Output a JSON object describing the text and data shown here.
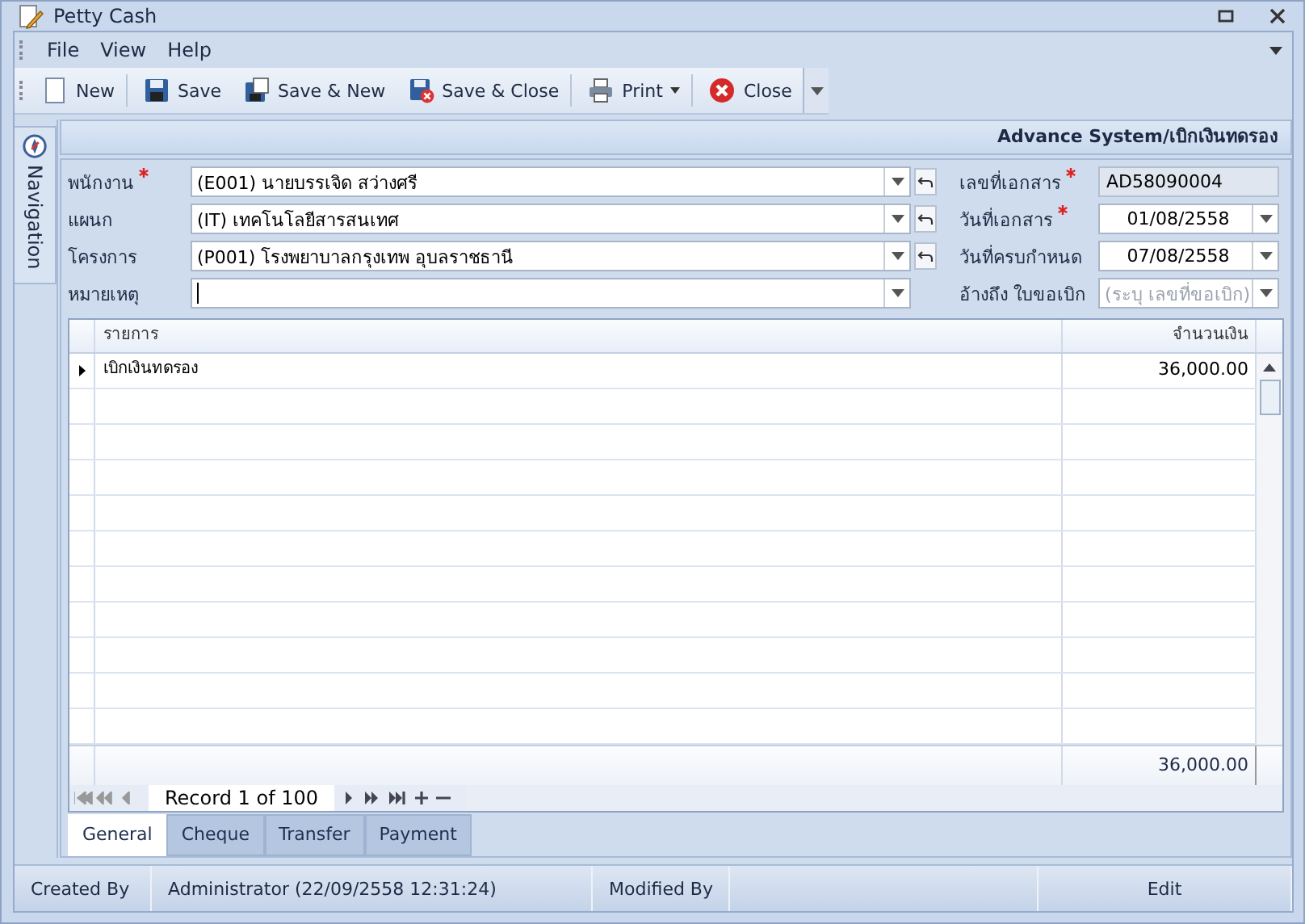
{
  "window": {
    "title": "Petty Cash"
  },
  "menu": [
    "File",
    "View",
    "Help"
  ],
  "toolbar": [
    {
      "kind": "new",
      "label": "New"
    },
    {
      "kind": "save",
      "label": "Save"
    },
    {
      "kind": "save_new",
      "label": "Save & New"
    },
    {
      "kind": "save_close",
      "label": "Save & Close"
    },
    {
      "kind": "print",
      "label": "Print"
    },
    {
      "kind": "close",
      "label": "Close"
    }
  ],
  "navigation": {
    "label": "Navigation"
  },
  "header": "Advance System/เบิกเงินทดรอง",
  "left_fields": [
    {
      "label": "พนักงาน",
      "required": true,
      "value": "(E001) นายบรรเจิด สว่างศรี",
      "reset": true
    },
    {
      "label": "แผนก",
      "required": false,
      "value": "(IT) เทคโนโลยีสารสนเทศ",
      "reset": true
    },
    {
      "label": "โครงการ",
      "required": false,
      "value": "(P001) โรงพยาบาลกรุงเทพ อุบลราชธานี",
      "reset": true
    },
    {
      "label": "หมายเหตุ",
      "required": false,
      "reset": false
    }
  ],
  "right_fields": [
    {
      "label": "เลขที่เอกสาร",
      "required": true,
      "kind": "readonly",
      "value": "AD58090004"
    },
    {
      "label": "วันที่เอกสาร",
      "required": true,
      "kind": "date",
      "value": "01/08/2558"
    },
    {
      "label": "วันที่ครบกำหนด",
      "required": false,
      "kind": "date",
      "value": "07/08/2558"
    },
    {
      "label": "อ้างถึง ใบขอเบิก",
      "required": false,
      "kind": "lookup",
      "placeholder": "(ระบุ เลขที่ขอเบิก)"
    }
  ],
  "grid": {
    "columns": [
      "รายการ",
      "จำนวนเงิน"
    ],
    "rows": [
      {
        "item": "เบิกเงินทดรอง",
        "amount": "36,000.00",
        "selected": true
      }
    ],
    "total": "36,000.00",
    "navigator": "Record 1 of 100"
  },
  "tabs": [
    {
      "label": "General",
      "selected": true
    },
    {
      "label": "Cheque",
      "selected": false
    },
    {
      "label": "Transfer",
      "selected": false
    },
    {
      "label": "Payment",
      "selected": false
    }
  ],
  "status_bar": {
    "created_by_label": "Created By",
    "created_by": "Administrator (22/09/2558 12:31:24)",
    "modified_by_label": "Modified By",
    "mode": "Edit"
  }
}
